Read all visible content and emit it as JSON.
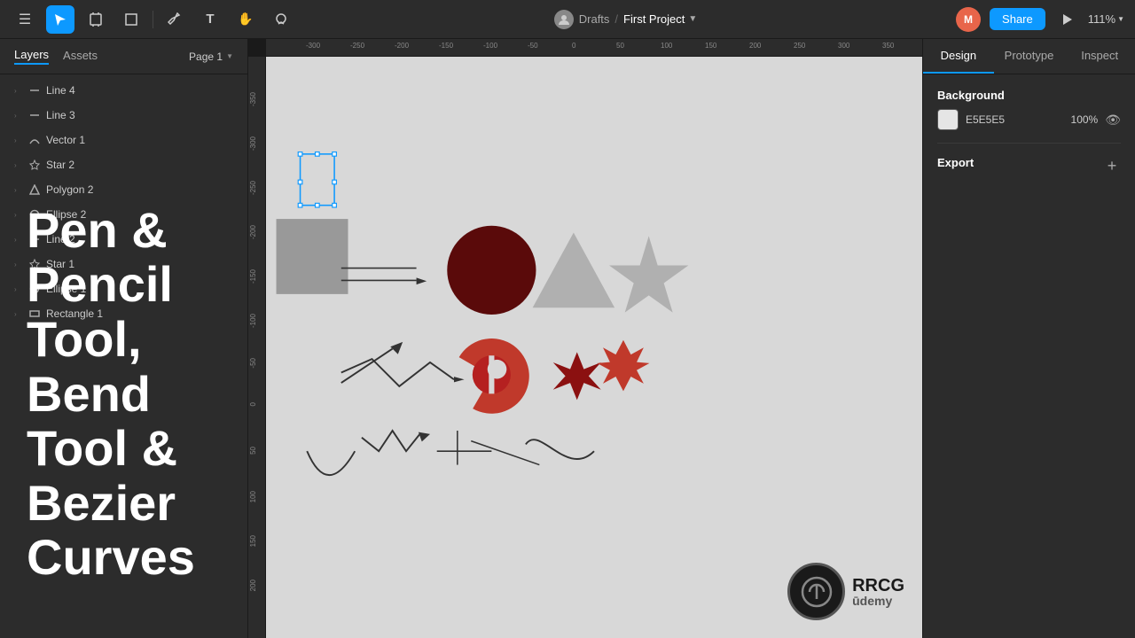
{
  "app": {
    "title": "First Project",
    "breadcrumb_separator": "/",
    "drafts_label": "Drafts",
    "project_name": "First Project"
  },
  "toolbar": {
    "tools": [
      {
        "name": "menu-icon",
        "symbol": "☰",
        "active": false
      },
      {
        "name": "select-tool",
        "symbol": "↖",
        "active": true
      },
      {
        "name": "frame-tool",
        "symbol": "⊞",
        "active": false
      },
      {
        "name": "shape-tool",
        "symbol": "□",
        "active": false
      },
      {
        "name": "pen-tool",
        "symbol": "✒",
        "active": false
      },
      {
        "name": "text-tool",
        "symbol": "T",
        "active": false
      },
      {
        "name": "hand-tool",
        "symbol": "✋",
        "active": false
      },
      {
        "name": "comment-tool",
        "symbol": "💬",
        "active": false
      }
    ],
    "share_label": "Share",
    "zoom_label": "111%"
  },
  "left_panel": {
    "tabs": [
      {
        "label": "Layers",
        "active": true
      },
      {
        "label": "Assets",
        "active": false
      }
    ],
    "page_selector": "Page 1",
    "layers": [
      {
        "name": "Line 4",
        "type": "line",
        "indent": 0
      },
      {
        "name": "Line 3",
        "type": "line",
        "indent": 0
      },
      {
        "name": "Vector 1",
        "type": "vector",
        "indent": 0
      },
      {
        "name": "Star 2",
        "type": "star",
        "indent": 0
      },
      {
        "name": "Polygon 2",
        "type": "polygon",
        "indent": 0
      },
      {
        "name": "Ellipse 2",
        "type": "ellipse",
        "indent": 0
      },
      {
        "name": "Line 2",
        "type": "line",
        "indent": 0
      },
      {
        "name": "Star 1",
        "type": "star",
        "indent": 0
      },
      {
        "name": "Ellipse 1",
        "type": "ellipse",
        "indent": 0
      },
      {
        "name": "Rectangle 1",
        "type": "rectangle",
        "indent": 0
      }
    ]
  },
  "overlay": {
    "line1": "Pen &",
    "line2": "Pencil Tool,",
    "line3": "Bend Tool &",
    "line4": "Bezier",
    "line5": "Curves"
  },
  "right_panel": {
    "tabs": [
      {
        "label": "Design",
        "active": true
      },
      {
        "label": "Prototype",
        "active": false
      },
      {
        "label": "Inspect",
        "active": false
      }
    ],
    "background": {
      "title": "Background",
      "color": "#E5E5E5",
      "hex_label": "E5E5E5",
      "opacity": "100%"
    },
    "export": {
      "title": "Export",
      "add_label": "+"
    }
  },
  "canvas": {
    "bg_color": "#d8d8d8",
    "ruler_color": "#2c2c2c"
  },
  "watermark": {
    "logo_text": "RRCG",
    "platform": "Udemy"
  }
}
